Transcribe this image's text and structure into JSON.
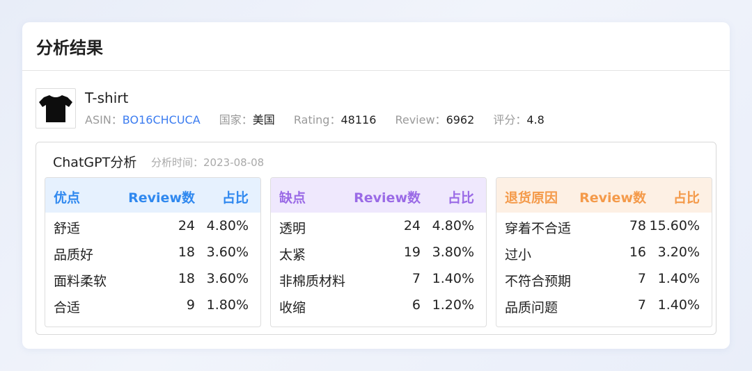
{
  "card": {
    "title": "分析结果"
  },
  "product": {
    "name": "T-shirt",
    "asin_label": "ASIN：",
    "asin": "BO16CHCUCA",
    "country_label": "国家：",
    "country": "美国",
    "rating_label": "Rating：",
    "rating": "48116",
    "review_label": "Review：",
    "review": "6962",
    "score_label": "评分：",
    "score": "4.8",
    "thumb_icon": "tshirt-icon"
  },
  "analysis": {
    "title": "ChatGPT分析",
    "time_label": "分析时间：",
    "time": "2023-08-08"
  },
  "panels": [
    {
      "label": "优点",
      "count_header": "Review数",
      "ratio_header": "占比",
      "color": "#2f88ef",
      "bg": "#e6f1fe",
      "rows": [
        {
          "label": "舒适",
          "count": "24",
          "ratio": "4.80%"
        },
        {
          "label": "品质好",
          "count": "18",
          "ratio": "3.60%"
        },
        {
          "label": "面料柔软",
          "count": "18",
          "ratio": "3.60%"
        },
        {
          "label": "合适",
          "count": "9",
          "ratio": "1.80%"
        }
      ]
    },
    {
      "label": "缺点",
      "count_header": "Review数",
      "ratio_header": "占比",
      "color": "#9a6ae6",
      "bg": "#efe8fd",
      "rows": [
        {
          "label": "透明",
          "count": "24",
          "ratio": "4.80%"
        },
        {
          "label": "太紧",
          "count": "19",
          "ratio": "3.80%"
        },
        {
          "label": "非棉质材料",
          "count": "7",
          "ratio": "1.40%"
        },
        {
          "label": "收缩",
          "count": "6",
          "ratio": "1.20%"
        }
      ]
    },
    {
      "label": "退货原因",
      "count_header": "Review数",
      "ratio_header": "占比",
      "color": "#f49a4a",
      "bg": "#fdf0e4",
      "rows": [
        {
          "label": "穿着不合适",
          "count": "78",
          "ratio": "15.60%"
        },
        {
          "label": "过小",
          "count": "16",
          "ratio": "3.20%"
        },
        {
          "label": "不符合预期",
          "count": "7",
          "ratio": "1.40%"
        },
        {
          "label": "品质问题",
          "count": "7",
          "ratio": "1.40%"
        }
      ]
    }
  ]
}
